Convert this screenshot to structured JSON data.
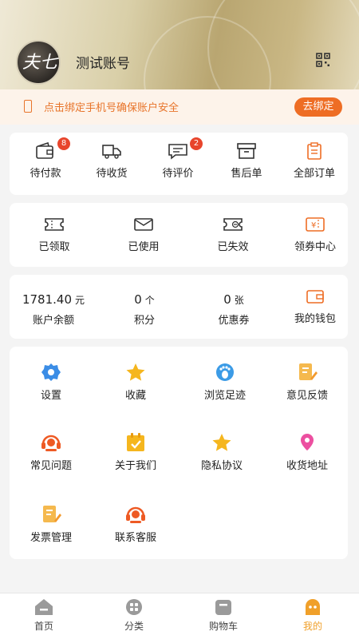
{
  "header": {
    "username": "测试账号",
    "avatar_text": "夫七"
  },
  "bind": {
    "message": "点击绑定手机号确保账户安全",
    "button": "去绑定"
  },
  "orders": [
    {
      "label": "待付款",
      "icon": "wallet-icon",
      "badge": "8"
    },
    {
      "label": "待收货",
      "icon": "truck-icon",
      "badge": ""
    },
    {
      "label": "待评价",
      "icon": "comment-icon",
      "badge": "2"
    },
    {
      "label": "售后单",
      "icon": "box-icon",
      "badge": ""
    },
    {
      "label": "全部订单",
      "icon": "clipboard-icon",
      "badge": ""
    }
  ],
  "coupons": [
    {
      "label": "已领取",
      "icon": "ticket-icon"
    },
    {
      "label": "已使用",
      "icon": "ticket-used-icon"
    },
    {
      "label": "已失效",
      "icon": "ticket-expired-icon"
    },
    {
      "label": "领券中心",
      "icon": "coupon-center-icon"
    }
  ],
  "assets": [
    {
      "value": "1781.40",
      "unit": "元",
      "label": "账户余额"
    },
    {
      "value": "0",
      "unit": "个",
      "label": "积分"
    },
    {
      "value": "0",
      "unit": "张",
      "label": "优惠券"
    },
    {
      "value": "",
      "unit": "",
      "label": "我的钱包"
    }
  ],
  "services": [
    {
      "label": "设置",
      "icon": "settings-icon"
    },
    {
      "label": "收藏",
      "icon": "star-icon"
    },
    {
      "label": "浏览足迹",
      "icon": "footprint-icon"
    },
    {
      "label": "意见反馈",
      "icon": "feedback-icon"
    },
    {
      "label": "常见问题",
      "icon": "headset-icon"
    },
    {
      "label": "关于我们",
      "icon": "calendar-icon"
    },
    {
      "label": "隐私协议",
      "icon": "star-icon"
    },
    {
      "label": "收货地址",
      "icon": "location-icon"
    },
    {
      "label": "发票管理",
      "icon": "invoice-icon"
    },
    {
      "label": "联系客服",
      "icon": "headset-icon"
    }
  ],
  "tabbar": [
    {
      "label": "首页",
      "icon": "home-icon",
      "active": false
    },
    {
      "label": "分类",
      "icon": "category-icon",
      "active": false
    },
    {
      "label": "购物车",
      "icon": "cart-icon",
      "active": false
    },
    {
      "label": "我的",
      "icon": "profile-icon",
      "active": true
    }
  ],
  "colors": {
    "accent": "#ee6d24",
    "active_tab": "#f0a02a",
    "badge": "#e8452c",
    "icon_blue": "#3b8de6",
    "icon_orange": "#f5a623"
  }
}
